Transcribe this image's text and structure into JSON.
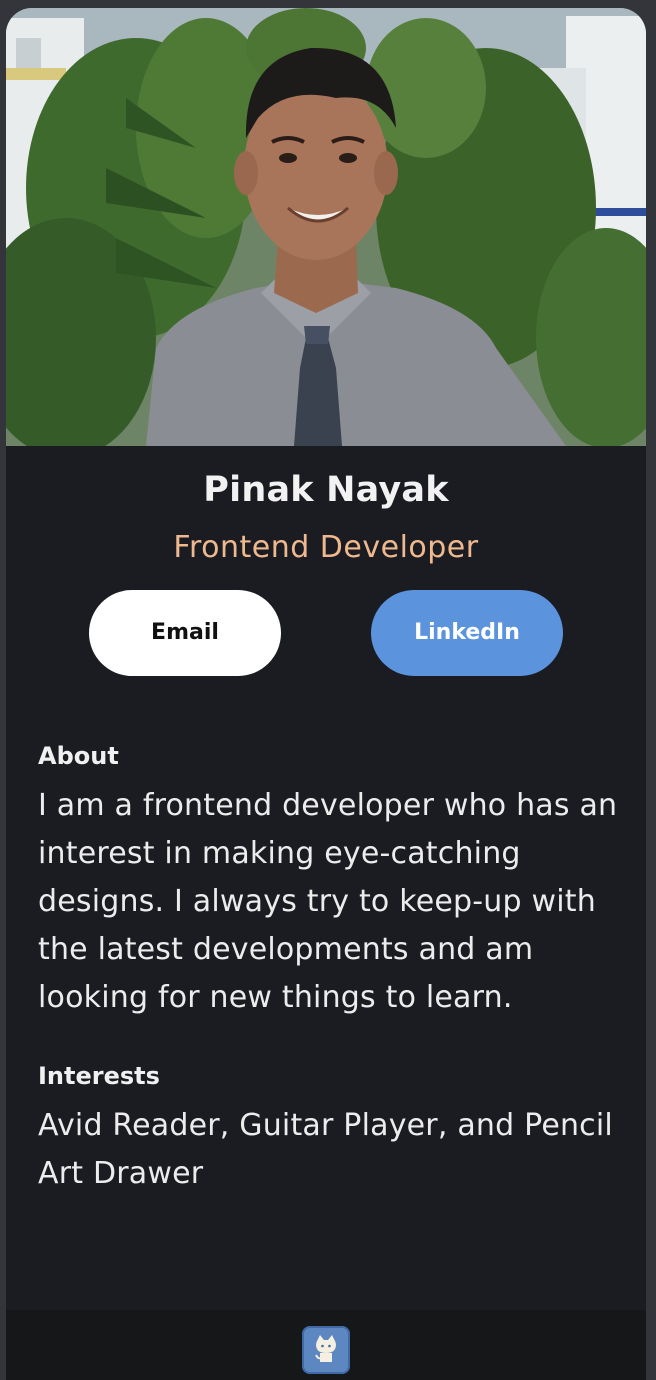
{
  "profile": {
    "name": "Pinak Nayak",
    "role": "Frontend Developer"
  },
  "buttons": {
    "email_label": "Email",
    "linkedin_label": "LinkedIn"
  },
  "about": {
    "title": "About",
    "body": "I am a frontend developer who has an interest in making eye-catching designs. I always try to keep-up with the latest developments and am looking for new things to learn."
  },
  "interests": {
    "title": "Interests",
    "body": "Avid Reader, Guitar Player, and Pencil Art Drawer"
  },
  "footer": {
    "icon": "github-icon"
  },
  "colors": {
    "background": "#1b1c22",
    "accent_role": "#efb98f",
    "linkedin_button": "#5b93dc",
    "email_button": "#ffffff"
  }
}
